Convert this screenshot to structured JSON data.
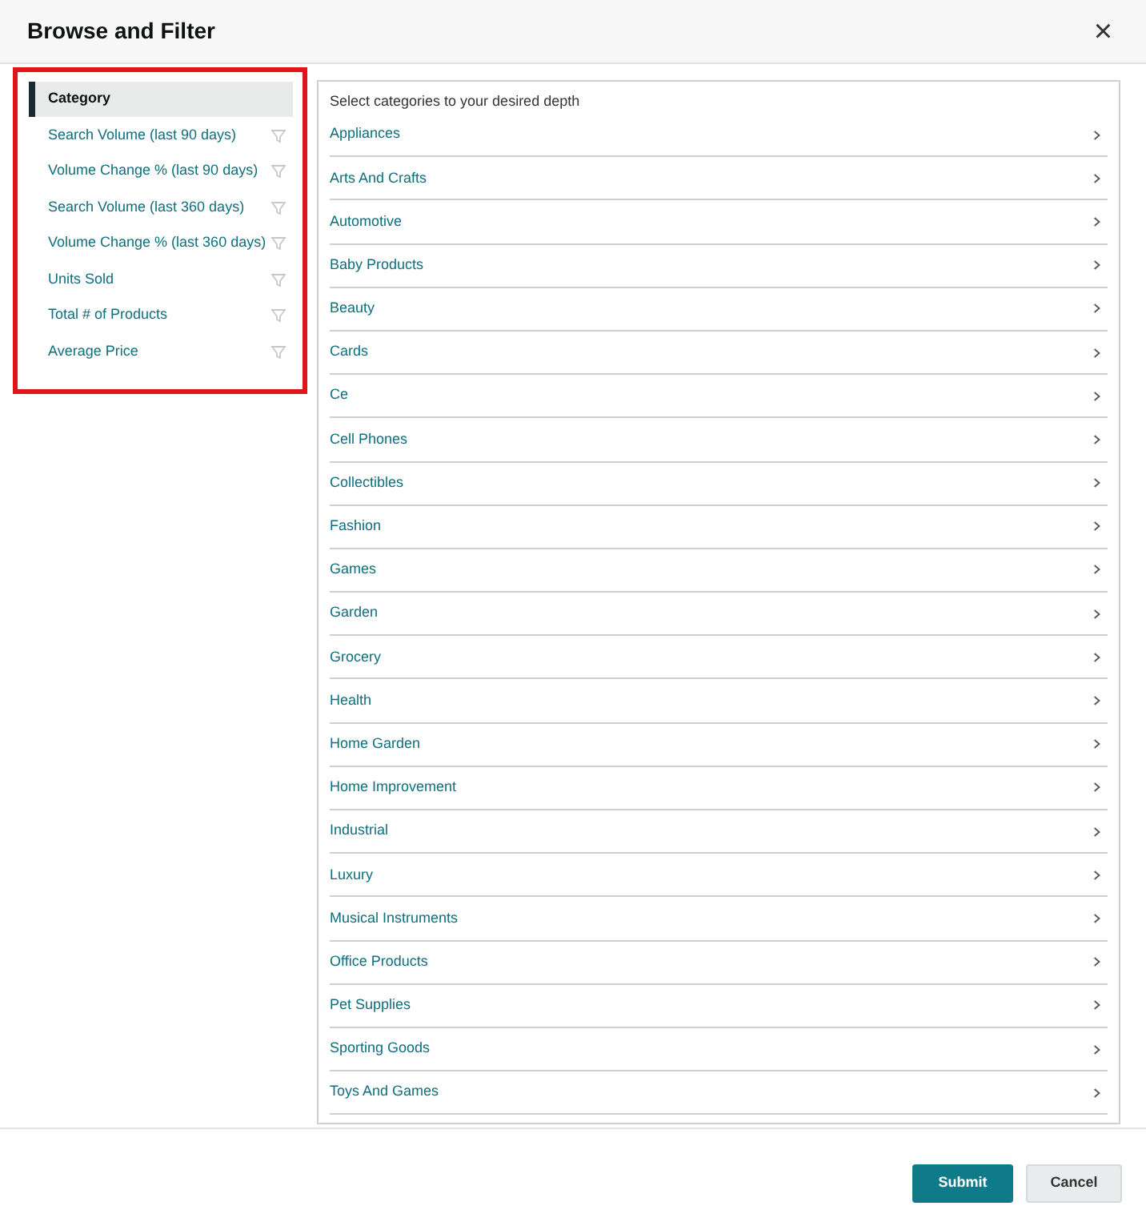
{
  "dialog": {
    "title": "Browse and Filter",
    "close": "×"
  },
  "filters": [
    {
      "label": "Category",
      "selected": true,
      "filterable": false
    },
    {
      "label": "Search Volume (last 90 days)",
      "selected": false,
      "filterable": true
    },
    {
      "label": "Volume Change % (last 90 days)",
      "selected": false,
      "filterable": true
    },
    {
      "label": "Search Volume (last 360 days)",
      "selected": false,
      "filterable": true
    },
    {
      "label": "Volume Change % (last 360 days)",
      "selected": false,
      "filterable": true
    },
    {
      "label": "Units Sold",
      "selected": false,
      "filterable": true
    },
    {
      "label": "Total # of Products",
      "selected": false,
      "filterable": true
    },
    {
      "label": "Average Price",
      "selected": false,
      "filterable": true
    }
  ],
  "categories": {
    "hint": "Select categories to your desired depth",
    "items": [
      "Appliances",
      "Arts And Crafts",
      "Automotive",
      "Baby Products",
      "Beauty",
      "Cards",
      "Ce",
      "Cell Phones",
      "Collectibles",
      "Fashion",
      "Games",
      "Garden",
      "Grocery",
      "Health",
      "Home Garden",
      "Home Improvement",
      "Industrial",
      "Luxury",
      "Musical Instruments",
      "Office Products",
      "Pet Supplies",
      "Sporting Goods",
      "Toys And Games"
    ]
  },
  "buttons": {
    "submit": "Submit",
    "cancel": "Cancel"
  }
}
